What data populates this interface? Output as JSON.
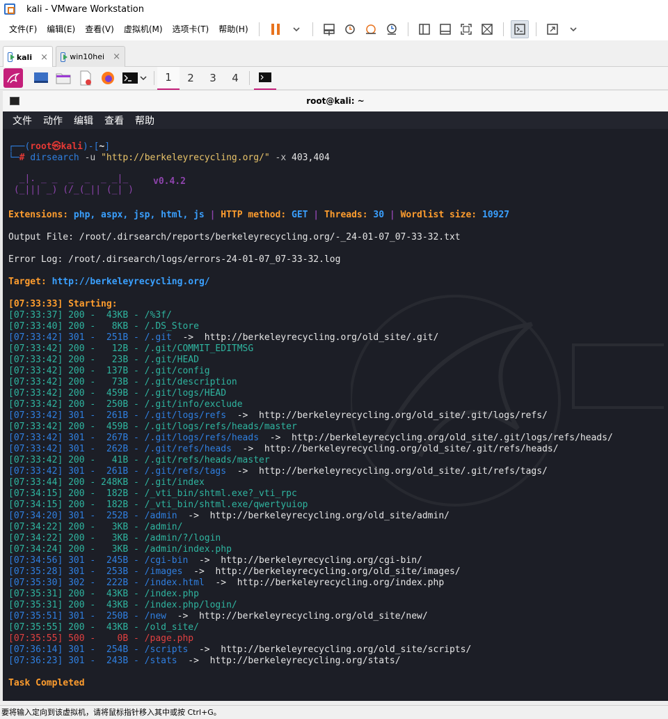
{
  "window": {
    "title": "kali - VMware Workstation"
  },
  "menubar": {
    "items": [
      "文件(F)",
      "编辑(E)",
      "查看(V)",
      "虚拟机(M)",
      "选项卡(T)",
      "帮助(H)"
    ]
  },
  "toolbar": {
    "icons": [
      "pause-icon",
      "send-keys-icon",
      "snapshot-icon",
      "revert-snapshot-icon",
      "snapshot-manager-icon",
      "sidebar-icon",
      "thumbnail-icon",
      "fullscreen-icon",
      "unity-icon",
      "console-view-icon",
      "stretch-icon"
    ]
  },
  "tabs": [
    {
      "label": "kali",
      "active": true
    },
    {
      "label": "win10hei",
      "active": false
    }
  ],
  "tab_close": "×",
  "kali_panel": {
    "workspaces": [
      "1",
      "2",
      "3",
      "4"
    ],
    "active_workspace": "1"
  },
  "terminal": {
    "title": "root@kali: ~",
    "menu": [
      "文件",
      "动作",
      "编辑",
      "查看",
      "帮助"
    ],
    "prompt": {
      "top_open": "┌──(",
      "user": "root㉿kali",
      "top_close": ")-[",
      "dir": "~",
      "dir_close": "]",
      "bottom": "└─",
      "hash": "# ",
      "cmd": "dirsearch",
      "arg1": " -u ",
      "url": "\"http://berkeleyrecycling.org/\"",
      "arg2": " -x ",
      "codes": "403,404"
    },
    "banner": {
      "line1": "  _|. _ _  _  _  _ _|_",
      "line2": " (_||| _) (/_(_|| (_| )",
      "version": "v0.4.2"
    },
    "info": {
      "ext_label": "Extensions: ",
      "ext_value": "php, aspx, jsp, html, js",
      "sep": " | ",
      "method_label": "HTTP method: ",
      "method_value": "GET",
      "threads_label": "Threads: ",
      "threads_value": "30",
      "wordlist_label": "Wordlist size: ",
      "wordlist_value": "10927"
    },
    "output_file": "Output File: /root/.dirsearch/reports/berkeleyrecycling.org/-_24-01-07_07-33-32.txt",
    "error_log": "Error Log: /root/.dirsearch/logs/errors-24-01-07_07-33-32.log",
    "target_label": "Target: ",
    "target_value": "http://berkeleyrecycling.org/",
    "starting": "[07:33:33] Starting:",
    "results": [
      {
        "t": "[07:33:37]",
        "code": "200",
        "size": "43KB",
        "path": "/%3f/",
        "redirect": ""
      },
      {
        "t": "[07:33:40]",
        "code": "200",
        "size": "8KB",
        "path": "/.DS_Store",
        "redirect": ""
      },
      {
        "t": "[07:33:42]",
        "code": "301",
        "size": "251B",
        "path": "/.git",
        "redirect": "http://berkeleyrecycling.org/old_site/.git/"
      },
      {
        "t": "[07:33:42]",
        "code": "200",
        "size": "12B",
        "path": "/.git/COMMIT_EDITMSG",
        "redirect": ""
      },
      {
        "t": "[07:33:42]",
        "code": "200",
        "size": "23B",
        "path": "/.git/HEAD",
        "redirect": ""
      },
      {
        "t": "[07:33:42]",
        "code": "200",
        "size": "137B",
        "path": "/.git/config",
        "redirect": ""
      },
      {
        "t": "[07:33:42]",
        "code": "200",
        "size": "73B",
        "path": "/.git/description",
        "redirect": ""
      },
      {
        "t": "[07:33:42]",
        "code": "200",
        "size": "459B",
        "path": "/.git/logs/HEAD",
        "redirect": ""
      },
      {
        "t": "[07:33:42]",
        "code": "200",
        "size": "250B",
        "path": "/.git/info/exclude",
        "redirect": ""
      },
      {
        "t": "[07:33:42]",
        "code": "301",
        "size": "261B",
        "path": "/.git/logs/refs",
        "redirect": "http://berkeleyrecycling.org/old_site/.git/logs/refs/"
      },
      {
        "t": "[07:33:42]",
        "code": "200",
        "size": "459B",
        "path": "/.git/logs/refs/heads/master",
        "redirect": ""
      },
      {
        "t": "[07:33:42]",
        "code": "301",
        "size": "267B",
        "path": "/.git/logs/refs/heads",
        "redirect": "http://berkeleyrecycling.org/old_site/.git/logs/refs/heads/"
      },
      {
        "t": "[07:33:42]",
        "code": "301",
        "size": "262B",
        "path": "/.git/refs/heads",
        "redirect": "http://berkeleyrecycling.org/old_site/.git/refs/heads/"
      },
      {
        "t": "[07:33:42]",
        "code": "200",
        "size": "41B",
        "path": "/.git/refs/heads/master",
        "redirect": ""
      },
      {
        "t": "[07:33:42]",
        "code": "301",
        "size": "261B",
        "path": "/.git/refs/tags",
        "redirect": "http://berkeleyrecycling.org/old_site/.git/refs/tags/"
      },
      {
        "t": "[07:33:44]",
        "code": "200",
        "size": "248KB",
        "path": "/.git/index",
        "redirect": ""
      },
      {
        "t": "[07:34:15]",
        "code": "200",
        "size": "182B",
        "path": "/_vti_bin/shtml.exe?_vti_rpc",
        "redirect": ""
      },
      {
        "t": "[07:34:15]",
        "code": "200",
        "size": "182B",
        "path": "/_vti_bin/shtml.exe/qwertyuiop",
        "redirect": ""
      },
      {
        "t": "[07:34:20]",
        "code": "301",
        "size": "252B",
        "path": "/admin",
        "redirect": "http://berkeleyrecycling.org/old_site/admin/"
      },
      {
        "t": "[07:34:22]",
        "code": "200",
        "size": "3KB",
        "path": "/admin/",
        "redirect": ""
      },
      {
        "t": "[07:34:22]",
        "code": "200",
        "size": "3KB",
        "path": "/admin/?/login",
        "redirect": ""
      },
      {
        "t": "[07:34:24]",
        "code": "200",
        "size": "3KB",
        "path": "/admin/index.php",
        "redirect": ""
      },
      {
        "t": "[07:34:56]",
        "code": "301",
        "size": "245B",
        "path": "/cgi-bin",
        "redirect": "http://berkeleyrecycling.org/cgi-bin/"
      },
      {
        "t": "[07:35:28]",
        "code": "301",
        "size": "253B",
        "path": "/images",
        "redirect": "http://berkeleyrecycling.org/old_site/images/"
      },
      {
        "t": "[07:35:30]",
        "code": "302",
        "size": "222B",
        "path": "/index.html",
        "redirect": "http://berkeleyrecycling.org/index.php"
      },
      {
        "t": "[07:35:31]",
        "code": "200",
        "size": "43KB",
        "path": "/index.php",
        "redirect": ""
      },
      {
        "t": "[07:35:31]",
        "code": "200",
        "size": "43KB",
        "path": "/index.php/login/",
        "redirect": ""
      },
      {
        "t": "[07:35:51]",
        "code": "301",
        "size": "250B",
        "path": "/new",
        "redirect": "http://berkeleyrecycling.org/old_site/new/"
      },
      {
        "t": "[07:35:55]",
        "code": "200",
        "size": "43KB",
        "path": "/old_site/",
        "redirect": ""
      },
      {
        "t": "[07:35:55]",
        "code": "500",
        "size": "0B",
        "path": "/page.php",
        "redirect": ""
      },
      {
        "t": "[07:36:14]",
        "code": "301",
        "size": "254B",
        "path": "/scripts",
        "redirect": "http://berkeleyrecycling.org/old_site/scripts/"
      },
      {
        "t": "[07:36:23]",
        "code": "301",
        "size": "243B",
        "path": "/stats",
        "redirect": "http://berkeleyrecycling.org/stats/"
      }
    ],
    "arrow": "->",
    "completed": "Task Completed"
  },
  "statusbar": {
    "text": "要将输入定向到该虚拟机，请将鼠标指针移入其中或按 Ctrl+G。"
  },
  "colors": {
    "accent": "#c41f7a",
    "term_bg": "#1c1e26",
    "blue": "#2f7fe0",
    "orange": "#ff9d2e",
    "error": "#e04040"
  }
}
